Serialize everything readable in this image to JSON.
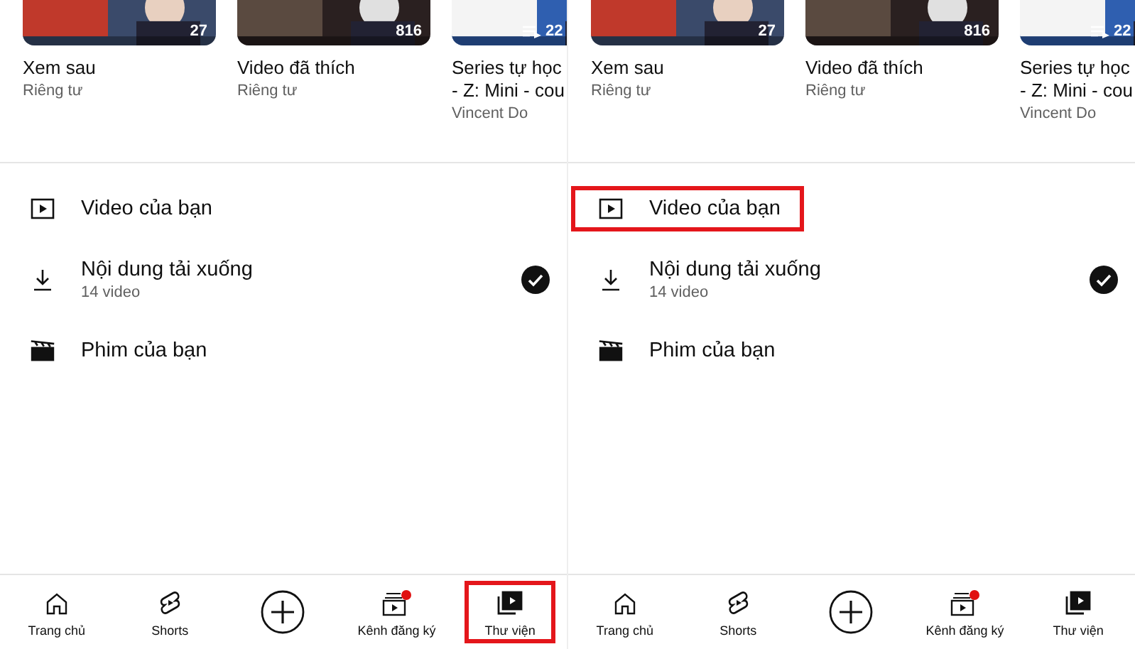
{
  "panels": [
    {
      "playlists": [
        {
          "title_lines": [
            "Xem sau"
          ],
          "subtitle": "Riêng tư",
          "count": "27",
          "kind": "plain"
        },
        {
          "title_lines": [
            "Video đã thích"
          ],
          "subtitle": "Riêng tư",
          "count": "816",
          "kind": "plain"
        },
        {
          "title_lines": [
            "Series tự học",
            "- Z: Mini - cou"
          ],
          "subtitle": "Vincent Do",
          "count": "22",
          "kind": "playlist"
        }
      ],
      "items": [
        {
          "kind": "videos",
          "label": "Video của bạn",
          "highlighted": false,
          "downloaded": false
        },
        {
          "kind": "downloads",
          "label": "Nội dung tải xuống",
          "sub": "14 video",
          "highlighted": false,
          "downloaded": true
        },
        {
          "kind": "movies",
          "label": "Phim của bạn",
          "highlighted": false,
          "downloaded": false
        }
      ],
      "nav": [
        {
          "kind": "home",
          "label": "Trang chủ",
          "selected": false,
          "highlighted": false
        },
        {
          "kind": "shorts",
          "label": "Shorts",
          "selected": false,
          "highlighted": false
        },
        {
          "kind": "create",
          "selected": false,
          "highlighted": false
        },
        {
          "kind": "subscriptions",
          "label": "Kênh đăng ký",
          "selected": false,
          "highlighted": false,
          "badge": true
        },
        {
          "kind": "library",
          "label": "Thư viện",
          "selected": true,
          "highlighted": true
        }
      ]
    },
    {
      "playlists": [
        {
          "title_lines": [
            "Xem sau"
          ],
          "subtitle": "Riêng tư",
          "count": "27",
          "kind": "plain"
        },
        {
          "title_lines": [
            "Video đã thích"
          ],
          "subtitle": "Riêng tư",
          "count": "816",
          "kind": "plain"
        },
        {
          "title_lines": [
            "Series tự học",
            "- Z: Mini - cou"
          ],
          "subtitle": "Vincent Do",
          "count": "22",
          "kind": "playlist"
        }
      ],
      "items": [
        {
          "kind": "videos",
          "label": "Video của bạn",
          "highlighted": true,
          "downloaded": false
        },
        {
          "kind": "downloads",
          "label": "Nội dung tải xuống",
          "sub": "14 video",
          "highlighted": false,
          "downloaded": true
        },
        {
          "kind": "movies",
          "label": "Phim của bạn",
          "highlighted": false,
          "downloaded": false
        }
      ],
      "nav": [
        {
          "kind": "home",
          "label": "Trang chủ",
          "selected": false,
          "highlighted": false
        },
        {
          "kind": "shorts",
          "label": "Shorts",
          "selected": false,
          "highlighted": false
        },
        {
          "kind": "create",
          "selected": false,
          "highlighted": false
        },
        {
          "kind": "subscriptions",
          "label": "Kênh đăng ký",
          "selected": false,
          "highlighted": false,
          "badge": true
        },
        {
          "kind": "library",
          "label": "Thư viện",
          "selected": true,
          "highlighted": false
        }
      ]
    }
  ]
}
